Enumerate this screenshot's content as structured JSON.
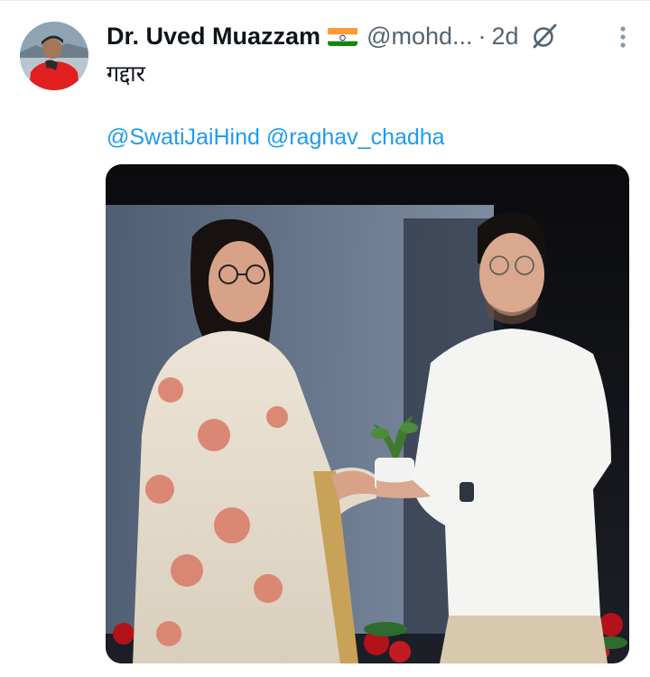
{
  "tweet": {
    "author": {
      "display_name": "Dr. Uved Muazzam",
      "flag_emoji": "🇮🇳",
      "handle": "@mohd...",
      "avatar_icon": "user-avatar-photo"
    },
    "separator": "·",
    "time": "2d",
    "text": "गद्दार",
    "mentions": [
      "@SwatiJaiHind",
      "@raghav_chadha"
    ],
    "media": {
      "icon": "photo-two-people-exchanging-plant"
    }
  },
  "icons": {
    "grok": "grok-icon",
    "more": "more-vertical-icon"
  },
  "colors": {
    "link": "#1d9bf0",
    "secondary_text": "#536471",
    "primary_text": "#0f1419"
  }
}
